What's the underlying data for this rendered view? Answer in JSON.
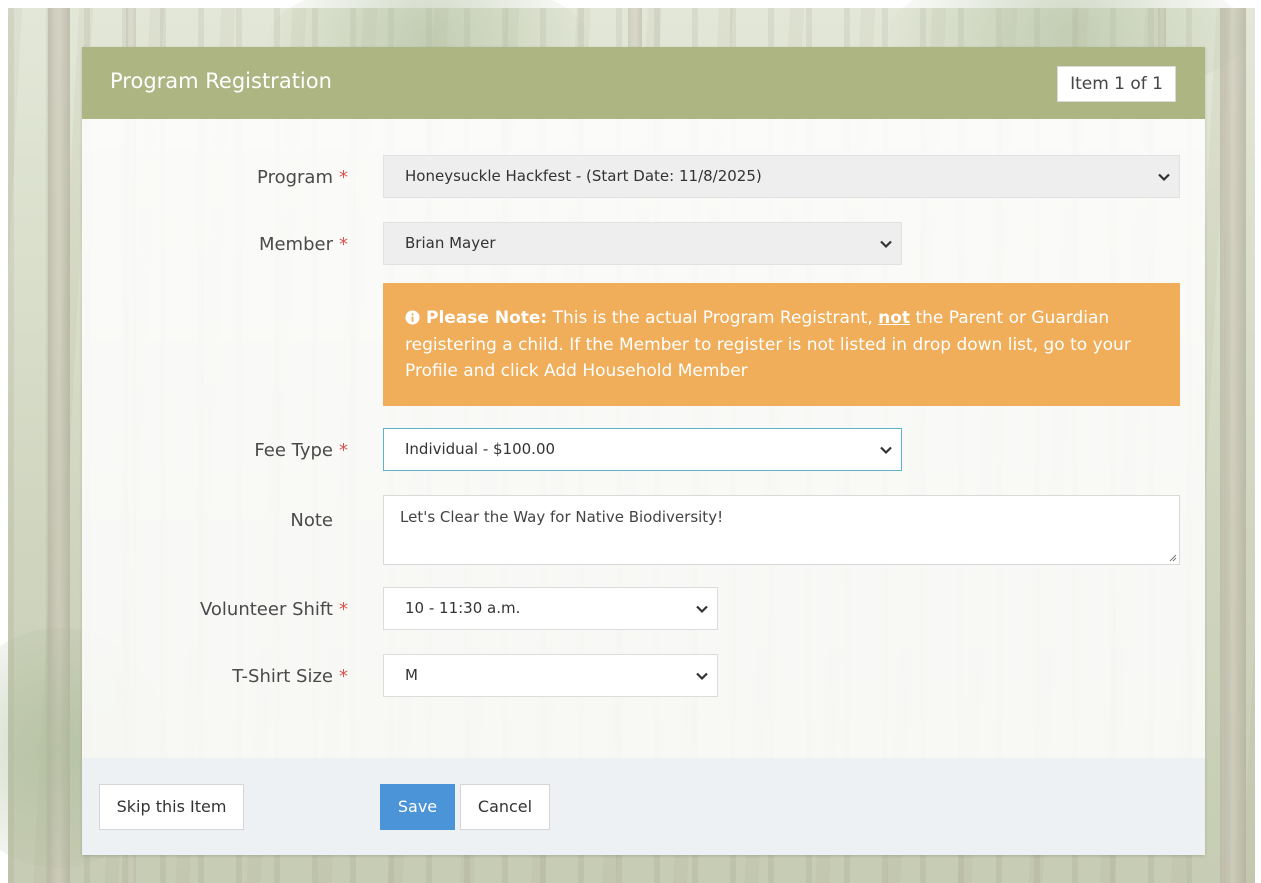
{
  "header": {
    "title": "Program Registration",
    "item_counter": "Item 1 of 1"
  },
  "form": {
    "required_marker": "*",
    "program": {
      "label": "Program",
      "value": "Honeysuckle Hackfest - (Start Date: 11/8/2025)"
    },
    "member": {
      "label": "Member",
      "value": "Brian Mayer"
    },
    "note_alert": {
      "lead": "Please Note:",
      "text1": " This is the actual Program Registrant, ",
      "emphasis": "not",
      "text2": " the Parent or Guardian registering a child. If the Member to register is not listed in drop down list, go to your Profile and click Add Household Member"
    },
    "fee_type": {
      "label": "Fee Type",
      "value": "Individual - $100.00"
    },
    "note": {
      "label": "Note",
      "value": "Let's Clear the Way for Native Biodiversity!"
    },
    "volunteer_shift": {
      "label": "Volunteer Shift",
      "value": "10 - 11:30 a.m."
    },
    "tshirt_size": {
      "label": "T-Shirt Size",
      "value": "M"
    }
  },
  "footer": {
    "skip_label": "Skip this Item",
    "save_label": "Save",
    "cancel_label": "Cancel"
  },
  "colors": {
    "header_bg": "#adb582",
    "alert_bg": "#f0ad5a",
    "primary_button": "#4b94d8",
    "required": "#d9534f",
    "focus_border": "#5fb3c6"
  },
  "icons": {
    "select_arrow": "chevron-down-icon",
    "alert": "info-circle-icon",
    "textarea_resize": "resize-handle-icon"
  }
}
